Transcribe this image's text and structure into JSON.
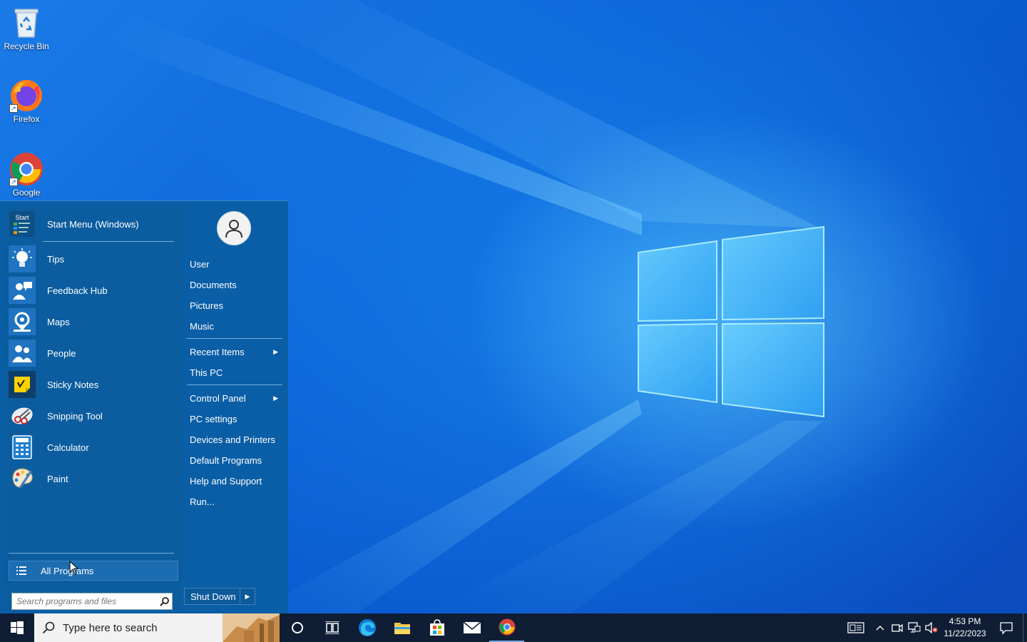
{
  "desktop": {
    "icons": [
      {
        "label": "Recycle Bin",
        "icon": "recycle-bin-icon"
      },
      {
        "label": "Firefox",
        "icon": "firefox-icon"
      },
      {
        "label": "Google",
        "icon": "chrome-icon"
      }
    ]
  },
  "start_menu": {
    "pinned": [
      {
        "label": "Start Menu (Windows)",
        "icon": "start-menu-app-icon",
        "icon_text": "Start"
      },
      {
        "label": "Tips",
        "icon": "lightbulb-icon"
      },
      {
        "label": "Feedback Hub",
        "icon": "feedback-icon"
      },
      {
        "label": "Maps",
        "icon": "map-pin-icon"
      },
      {
        "label": "People",
        "icon": "people-icon"
      },
      {
        "label": "Sticky Notes",
        "icon": "sticky-note-icon"
      },
      {
        "label": "Snipping Tool",
        "icon": "scissors-icon"
      },
      {
        "label": "Calculator",
        "icon": "calculator-icon"
      },
      {
        "label": "Paint",
        "icon": "palette-icon"
      }
    ],
    "all_programs": "All Programs",
    "search_placeholder": "Search programs and files",
    "right_links": [
      {
        "label": "User"
      },
      {
        "label": "Documents"
      },
      {
        "label": "Pictures"
      },
      {
        "label": "Music"
      },
      {
        "label": "Recent Items",
        "submenu": true
      },
      {
        "label": "This PC"
      },
      {
        "label": "Control Panel",
        "submenu": true
      },
      {
        "label": "PC settings"
      },
      {
        "label": "Devices and Printers"
      },
      {
        "label": "Default Programs"
      },
      {
        "label": "Help and Support"
      },
      {
        "label": "Run..."
      }
    ],
    "shutdown": "Shut Down"
  },
  "taskbar": {
    "search_text": "Type here to search",
    "apps": [
      "cortana-icon",
      "task-view-icon",
      "edge-icon",
      "file-explorer-icon",
      "store-icon",
      "mail-icon",
      "chrome-icon"
    ],
    "time": "4:53 PM",
    "date": "11/22/2023"
  },
  "colors": {
    "start_menu_bg": "#0a5ea6",
    "taskbar_bg": "#0f1e35",
    "wallpaper": "#0c64d8"
  }
}
